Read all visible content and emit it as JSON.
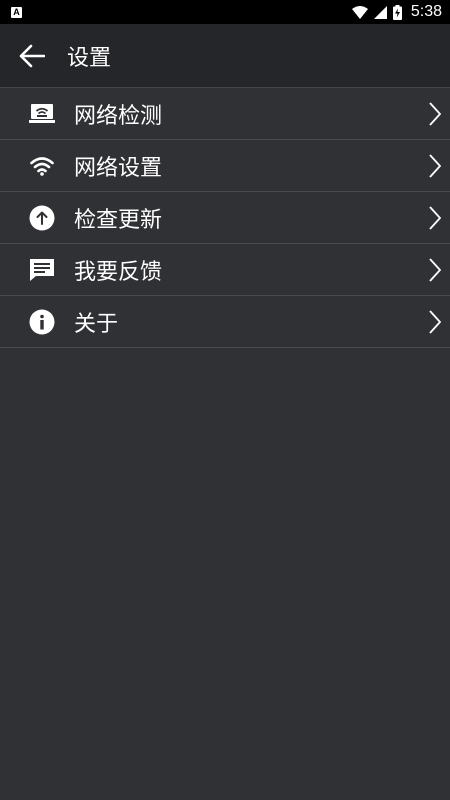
{
  "status_bar": {
    "notification_icon": "A",
    "time": "5:38"
  },
  "header": {
    "title": "设置"
  },
  "menu": {
    "items": [
      {
        "label": "网络检测",
        "icon": "network-check-icon"
      },
      {
        "label": "网络设置",
        "icon": "wifi-icon"
      },
      {
        "label": "检查更新",
        "icon": "upload-arrow-icon"
      },
      {
        "label": "我要反馈",
        "icon": "chat-feedback-icon"
      },
      {
        "label": "关于",
        "icon": "info-icon"
      }
    ]
  },
  "colors": {
    "background": "#303135",
    "app_bar": "#25262a",
    "divider": "#4a4b50",
    "text": "#ffffff"
  }
}
